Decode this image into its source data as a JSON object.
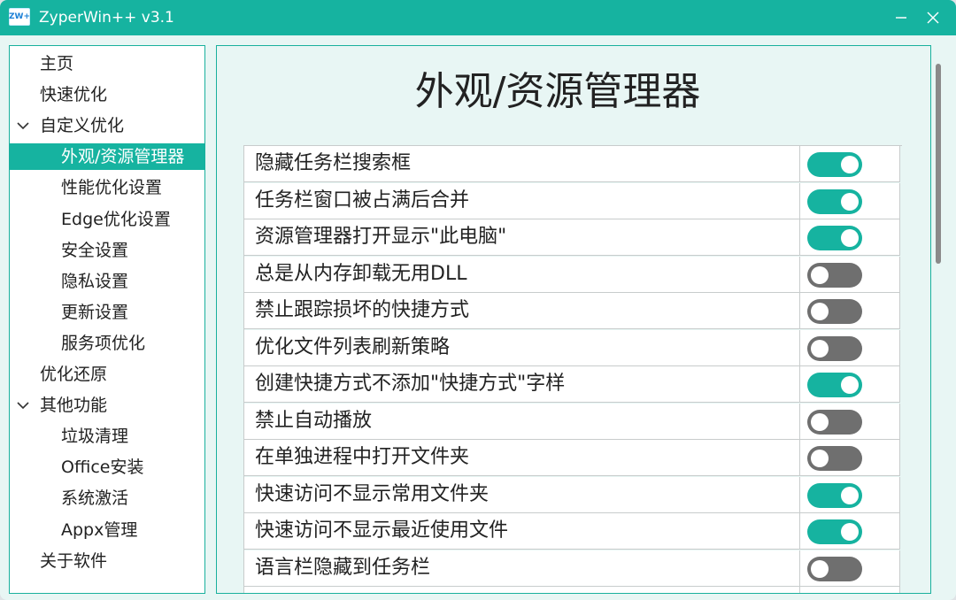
{
  "window": {
    "title": "ZyperWin++ v3.1",
    "icon_label": "ZW+",
    "accent": "#16b3a0"
  },
  "sidebar": {
    "items": [
      {
        "label": "主页",
        "level": 0
      },
      {
        "label": "快速优化",
        "level": 0
      },
      {
        "label": "自定义优化",
        "level": 0,
        "expanded": true
      },
      {
        "label": "外观/资源管理器",
        "level": 1,
        "active": true
      },
      {
        "label": "性能优化设置",
        "level": 1
      },
      {
        "label": "Edge优化设置",
        "level": 1
      },
      {
        "label": "安全设置",
        "level": 1
      },
      {
        "label": "隐私设置",
        "level": 1
      },
      {
        "label": "更新设置",
        "level": 1
      },
      {
        "label": "服务项优化",
        "level": 1
      },
      {
        "label": "优化还原",
        "level": 0
      },
      {
        "label": "其他功能",
        "level": 0,
        "expanded": true
      },
      {
        "label": "垃圾清理",
        "level": 1
      },
      {
        "label": "Office安装",
        "level": 1
      },
      {
        "label": "系统激活",
        "level": 1
      },
      {
        "label": "Appx管理",
        "level": 1
      },
      {
        "label": "关于软件",
        "level": 0
      }
    ]
  },
  "main": {
    "title": "外观/资源管理器",
    "settings": [
      {
        "label": "隐藏任务栏搜索框",
        "enabled": true
      },
      {
        "label": "任务栏窗口被占满后合并",
        "enabled": true
      },
      {
        "label": "资源管理器打开显示\"此电脑\"",
        "enabled": true
      },
      {
        "label": "总是从内存卸载无用DLL",
        "enabled": false
      },
      {
        "label": "禁止跟踪损坏的快捷方式",
        "enabled": false
      },
      {
        "label": "优化文件列表刷新策略",
        "enabled": false
      },
      {
        "label": "创建快捷方式不添加\"快捷方式\"字样",
        "enabled": true
      },
      {
        "label": "禁止自动播放",
        "enabled": false
      },
      {
        "label": "在单独进程中打开文件夹",
        "enabled": false
      },
      {
        "label": "快速访问不显示常用文件夹",
        "enabled": true
      },
      {
        "label": "快速访问不显示最近使用文件",
        "enabled": true
      },
      {
        "label": "语言栏隐藏到任务栏",
        "enabled": false
      }
    ]
  }
}
